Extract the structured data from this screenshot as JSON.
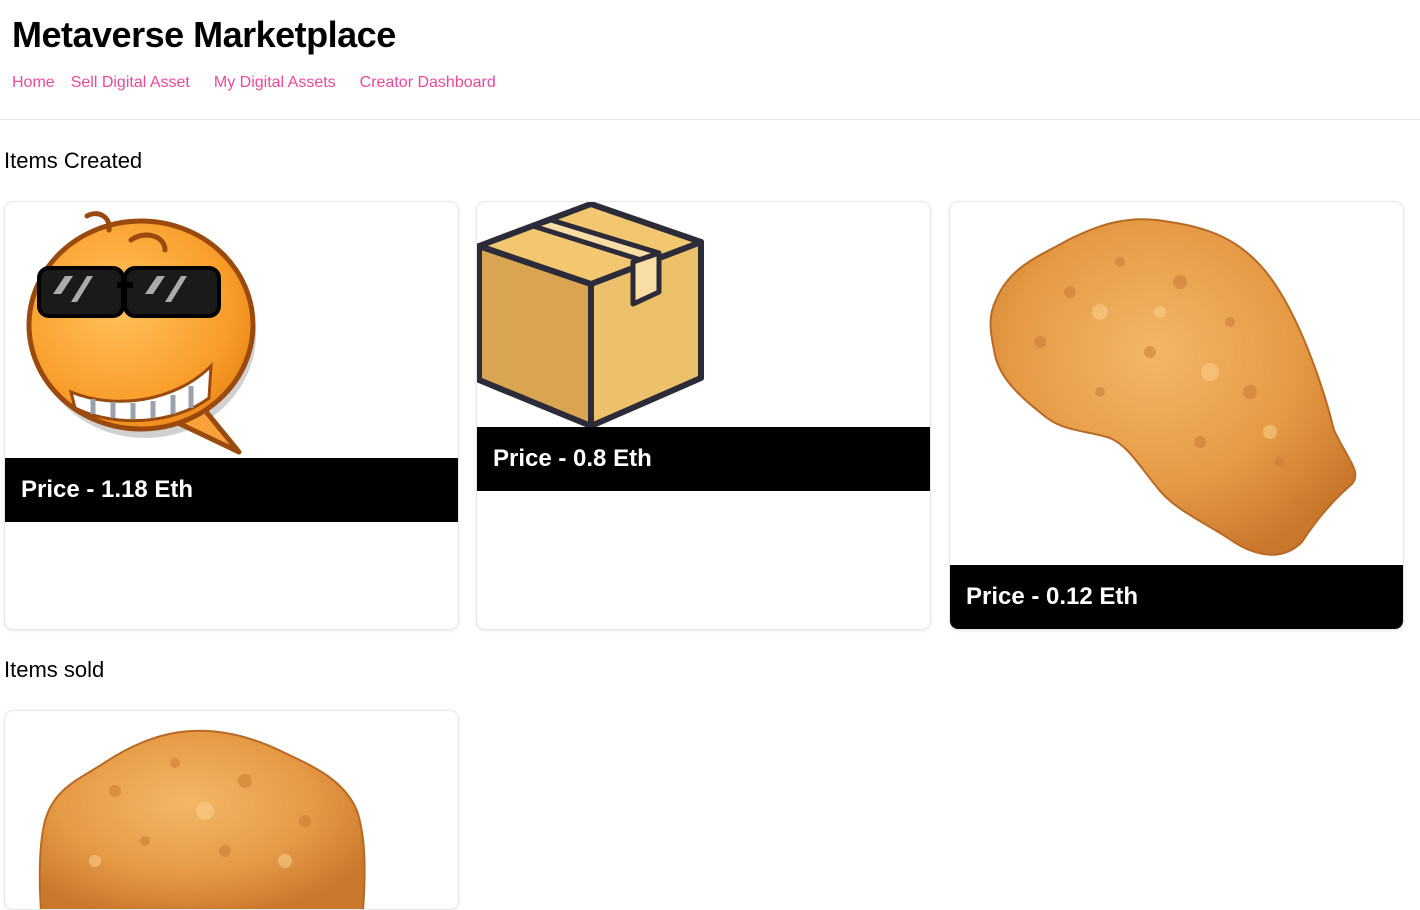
{
  "header": {
    "title": "Metaverse Marketplace",
    "nav": [
      "Home",
      "Sell Digital Asset",
      "My Digital Assets",
      "Creator Dashboard"
    ]
  },
  "sections": {
    "created": {
      "heading": "Items Created",
      "items": [
        {
          "image": "cool-emoji-sunglasses",
          "price_label": "Price - 1.18 Eth"
        },
        {
          "image": "cardboard-box",
          "price_label": "Price - 0.8 Eth"
        },
        {
          "image": "fried-chicken-nugget",
          "price_label": "Price - 0.12 Eth"
        }
      ]
    },
    "sold": {
      "heading": "Items sold",
      "items": [
        {
          "image": "fried-chicken-nugget"
        }
      ]
    }
  },
  "colors": {
    "accent": "#ec4899",
    "price_bar": "#000000",
    "border": "#e5e7eb"
  }
}
